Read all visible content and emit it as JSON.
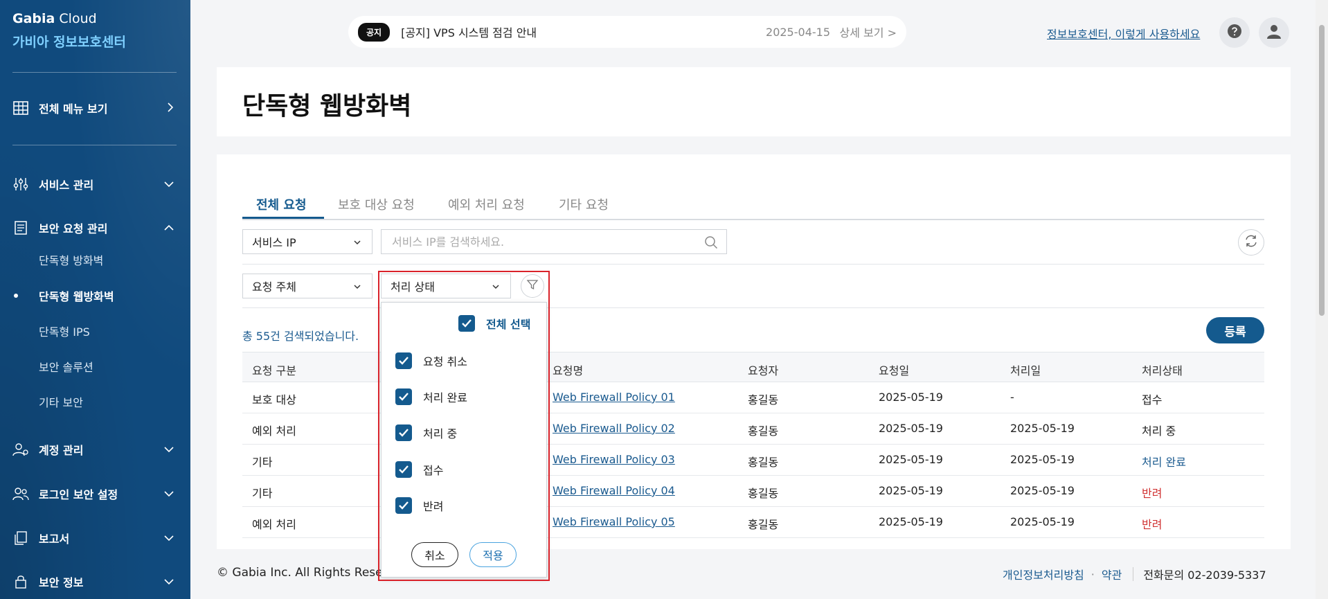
{
  "brand": {
    "line1_bold": "Gabia",
    "line1_rest": " Cloud",
    "line2": "가비아 정보보호센터"
  },
  "sidebar": {
    "all_menu": "전체 메뉴 보기",
    "sections": [
      {
        "label": "서비스 관리",
        "icon": "sliders-icon"
      },
      {
        "label": "보안 요청 관리",
        "icon": "document-icon"
      },
      {
        "label": "계정 관리",
        "icon": "user-gear-icon"
      },
      {
        "label": "로그인 보안 설정",
        "icon": "users-icon"
      },
      {
        "label": "보고서",
        "icon": "copy-icon"
      },
      {
        "label": "보안 정보",
        "icon": "lock-icon"
      }
    ],
    "sub_items": [
      {
        "label": "단독형 방화벽"
      },
      {
        "label": "단독형 웹방화벽",
        "active": true
      },
      {
        "label": "단독형 IPS"
      },
      {
        "label": "보안 솔루션"
      },
      {
        "label": "기타 보안"
      }
    ]
  },
  "topbar": {
    "notice_tag": "공지",
    "notice_text": "[공지] VPS 시스템 점검 안내",
    "notice_date": "2025-04-15",
    "notice_more": "상세 보기 >",
    "help_link": "정보보호센터, 이렇게 사용하세요"
  },
  "page": {
    "title": "단독형 웹방화벽"
  },
  "tabs": [
    {
      "label": "전체 요청",
      "active": true
    },
    {
      "label": "보호 대상 요청"
    },
    {
      "label": "예외 처리 요청"
    },
    {
      "label": "기타 요청"
    }
  ],
  "filters": {
    "search_type": "서비스 IP",
    "search_placeholder": "서비스 IP를 검색하세요.",
    "requester_select": "요청 주체",
    "status_select": "처리 상태"
  },
  "status_dropdown": {
    "select_all": "전체 선택",
    "options": [
      "요청 취소",
      "처리 완료",
      "처리 중",
      "접수",
      "반려"
    ],
    "cancel": "취소",
    "apply": "적용"
  },
  "results": {
    "total_text": "총 55건 검색되었습니다.",
    "register": "등록"
  },
  "table": {
    "headers": [
      "요청 구분",
      "요청명",
      "요청자",
      "요청일",
      "처리일",
      "처리상태"
    ],
    "rows": [
      [
        "보호 대상",
        "Web Firewall Policy 01",
        "홍길동",
        "2025-05-19",
        "-",
        "접수"
      ],
      [
        "예외 처리",
        "Web Firewall Policy 02",
        "홍길동",
        "2025-05-19",
        "2025-05-19",
        "처리 중"
      ],
      [
        "기타",
        "Web Firewall Policy 03",
        "홍길동",
        "2025-05-19",
        "2025-05-19",
        "처리 완료"
      ],
      [
        "기타",
        "Web Firewall Policy 04",
        "홍길동",
        "2025-05-19",
        "2025-05-19",
        "반려"
      ],
      [
        "예외 처리",
        "Web Firewall Policy 05",
        "홍길동",
        "2025-05-19",
        "2025-05-19",
        "반려"
      ]
    ]
  },
  "footer": {
    "copyright": "© Gabia Inc. All Rights Reserved.",
    "privacy": "개인정보처리방침",
    "dot": "·",
    "terms": "약관",
    "phone": "전화문의 02-2039-5337"
  },
  "colors": {
    "primary": "#145a8e",
    "sidebar": "#104a7d",
    "reject": "#d03030",
    "highlight": "#d9222a"
  }
}
